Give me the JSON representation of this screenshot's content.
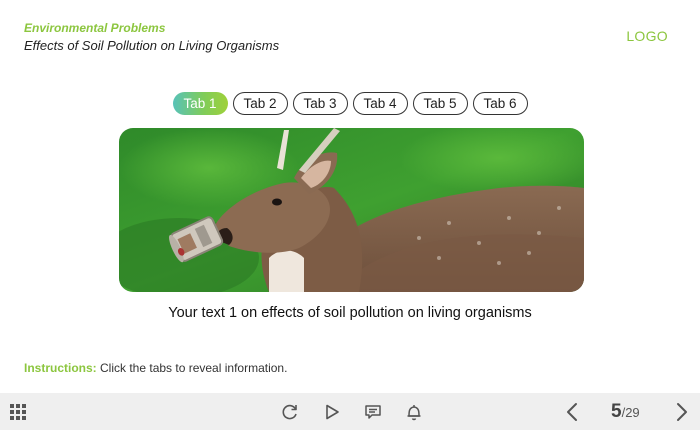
{
  "header": {
    "course_title": "Environmental Problems",
    "slide_title": "Effects of Soil Pollution on Living Organisms",
    "logo": "LOGO"
  },
  "tabs": [
    {
      "label": "Tab 1",
      "active": true
    },
    {
      "label": "Tab 2",
      "active": false
    },
    {
      "label": "Tab 3",
      "active": false
    },
    {
      "label": "Tab 4",
      "active": false
    },
    {
      "label": "Tab 5",
      "active": false
    },
    {
      "label": "Tab 6",
      "active": false
    }
  ],
  "content": {
    "image": "deer-with-can-photo",
    "caption": "Your text 1 on effects of soil pollution on living organisms"
  },
  "instructions": {
    "label": "Instructions:",
    "text": " Click the tabs to reveal information."
  },
  "player": {
    "icons": [
      "menu-grid-icon",
      "replay-icon",
      "play-icon",
      "captions-icon",
      "bell-icon",
      "chevron-left-icon",
      "chevron-right-icon"
    ],
    "current_slide": "5",
    "total_slides": "/29"
  },
  "colors": {
    "accent": "#8cc63f",
    "tab_gradient_start": "#58c2b8",
    "tab_gradient_end": "#9fd13a",
    "bar_background": "#efefef"
  }
}
